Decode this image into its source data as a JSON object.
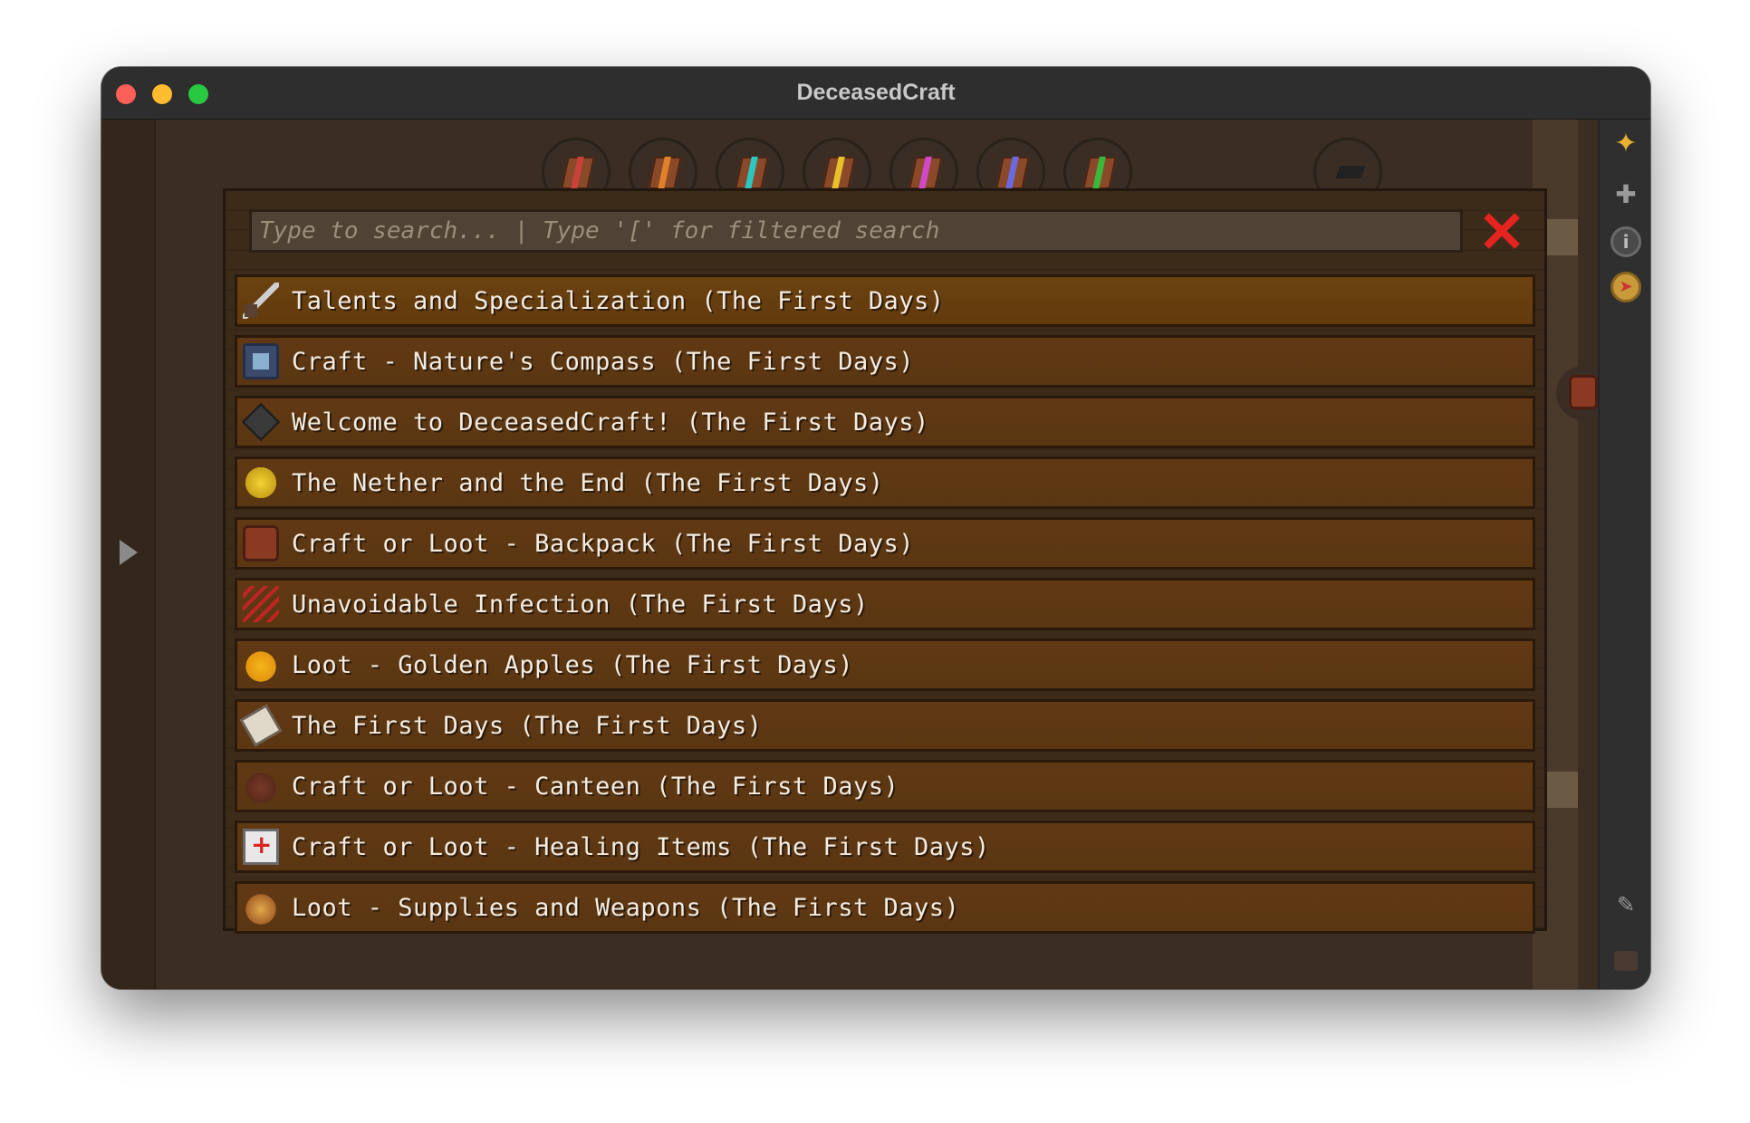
{
  "window": {
    "title": "DeceasedCraft"
  },
  "tabs": [
    {
      "icon": "red-book-icon",
      "color": "#c8423a"
    },
    {
      "icon": "orange-book-icon",
      "color": "#e0802a"
    },
    {
      "icon": "cyan-book-icon",
      "color": "#2ac8c0"
    },
    {
      "icon": "yellow-book-icon",
      "color": "#e8c02a"
    },
    {
      "icon": "magenta-book-icon",
      "color": "#d04ac8"
    },
    {
      "icon": "blue-book-icon",
      "color": "#6a6ae0"
    },
    {
      "icon": "green-book-icon",
      "color": "#3ab83a"
    }
  ],
  "search": {
    "placeholder": "Type to search... | Type '[' for filtered search",
    "value": ""
  },
  "quests": [
    {
      "label": "Talents and Specialization (The First Days)",
      "icon": "sword-icon"
    },
    {
      "label": "Craft - Nature's Compass (The First Days)",
      "icon": "compass-icon"
    },
    {
      "label": "Welcome to DeceasedCraft! (The First Days)",
      "icon": "cube-icon"
    },
    {
      "label": "The Nether and the End (The First Days)",
      "icon": "gold-nugget-icon"
    },
    {
      "label": "Craft or Loot - Backpack (The First Days)",
      "icon": "backpack-icon"
    },
    {
      "label": "Unavoidable Infection (The First Days)",
      "icon": "claw-icon"
    },
    {
      "label": "Loot - Golden Apples (The First Days)",
      "icon": "golden-apple-icon"
    },
    {
      "label": "The First Days (The First Days)",
      "icon": "scroll-icon"
    },
    {
      "label": "Craft or Loot - Canteen (The First Days)",
      "icon": "canteen-icon"
    },
    {
      "label": "Craft or Loot - Healing Items (The First Days)",
      "icon": "medkit-icon"
    },
    {
      "label": "Loot - Supplies and Weapons (The First Days)",
      "icon": "supplies-icon"
    }
  ],
  "sidebar_icons": [
    "bookmark-icon",
    "pin-icon",
    "info-icon",
    "compass-icon",
    "edit-icon",
    "player-head-icon"
  ],
  "colors": {
    "accent": "#e52420",
    "panel": "#3d2b1a",
    "row": "#613914"
  }
}
